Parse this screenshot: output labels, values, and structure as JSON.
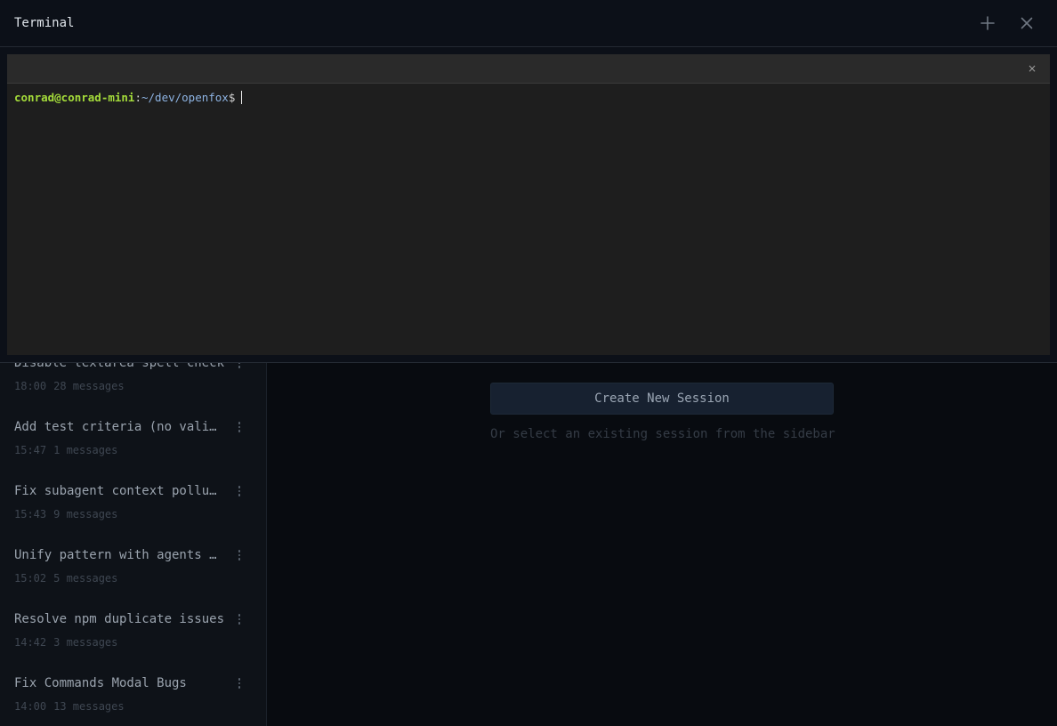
{
  "terminal_panel": {
    "title": "Terminal",
    "new_icon": "plus-icon",
    "close_icon": "close-icon",
    "tab_close_glyph": "×",
    "prompt": {
      "user_host": "conrad@conrad-mini",
      "separator": ":",
      "path": "~/dev/openfox",
      "symbol": "$"
    }
  },
  "sidebar": {
    "sessions": [
      {
        "title": "Disable textarea spell check",
        "time": "18:00",
        "messages": "28 messages"
      },
      {
        "title": "Add test criteria (no validation)",
        "time": "15:47",
        "messages": "1 messages"
      },
      {
        "title": "Fix subagent context pollution",
        "time": "15:43",
        "messages": "9 messages"
      },
      {
        "title": "Unify pattern with agents and skills",
        "time": "15:02",
        "messages": "5 messages"
      },
      {
        "title": "Resolve npm duplicate issues",
        "time": "14:42",
        "messages": "3 messages"
      },
      {
        "title": "Fix Commands Modal Bugs",
        "time": "14:00",
        "messages": "13 messages"
      }
    ]
  },
  "main": {
    "create_button_label": "Create New Session",
    "hint_text": "Or select an existing session from the sidebar"
  },
  "colors": {
    "prompt_user": "#a4db3a",
    "prompt_path": "#8db3e2",
    "background": "#080b10",
    "terminal_bg": "#1e1e1e"
  }
}
